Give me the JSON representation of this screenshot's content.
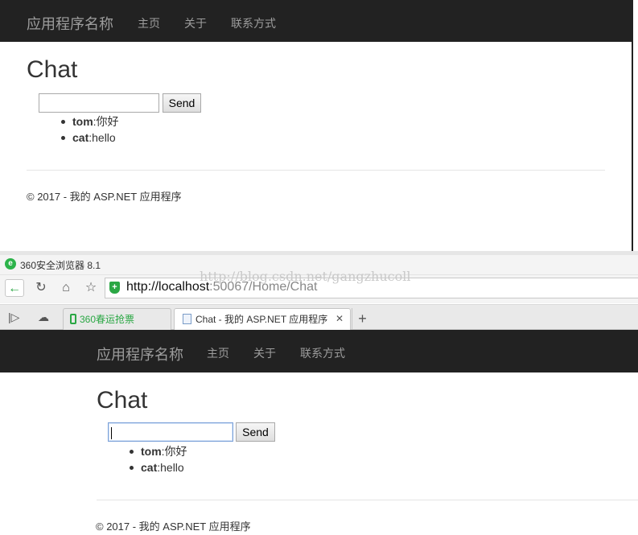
{
  "top_window": {
    "navbar": {
      "brand": "应用程序名称",
      "links": [
        "主页",
        "关于",
        "联系方式"
      ]
    },
    "heading": "Chat",
    "message_input": {
      "value": ""
    },
    "send_label": "Send",
    "messages": [
      {
        "user": "tom",
        "text": ":你好"
      },
      {
        "user": "cat",
        "text": ":hello"
      }
    ],
    "footer": "© 2017 - 我的 ASP.NET 应用程序"
  },
  "browser": {
    "title": "360安全浏览器 8.1",
    "logo_glyph": "e",
    "url_host": "http://localhost",
    "url_rest": ":50067/Home/Chat",
    "watermark": "http://blog.csdn.net/gangzhucoll",
    "tabs": [
      {
        "label": "360春运抢票",
        "active": false
      },
      {
        "label": "Chat - 我的 ASP.NET 应用程序",
        "active": true
      }
    ],
    "icons": [
      "back-arrow-icon",
      "reload-icon",
      "home-icon",
      "star-icon",
      "shield-icon",
      "sidebar-toggle-icon",
      "cloud-icon",
      "tab-close-icon",
      "new-tab-icon"
    ]
  },
  "page": {
    "navbar": {
      "brand": "应用程序名称",
      "links": [
        "主页",
        "关于",
        "联系方式"
      ]
    },
    "heading": "Chat",
    "message_input": {
      "value": ""
    },
    "send_label": "Send",
    "messages": [
      {
        "user": "tom",
        "text": ":你好"
      },
      {
        "user": "cat",
        "text": ":hello"
      }
    ],
    "footer": "© 2017 - 我的 ASP.NET 应用程序"
  },
  "colors": {
    "navbar_bg": "#222222",
    "navbar_text": "#9d9d9d",
    "brand_green": "#2aa744"
  }
}
